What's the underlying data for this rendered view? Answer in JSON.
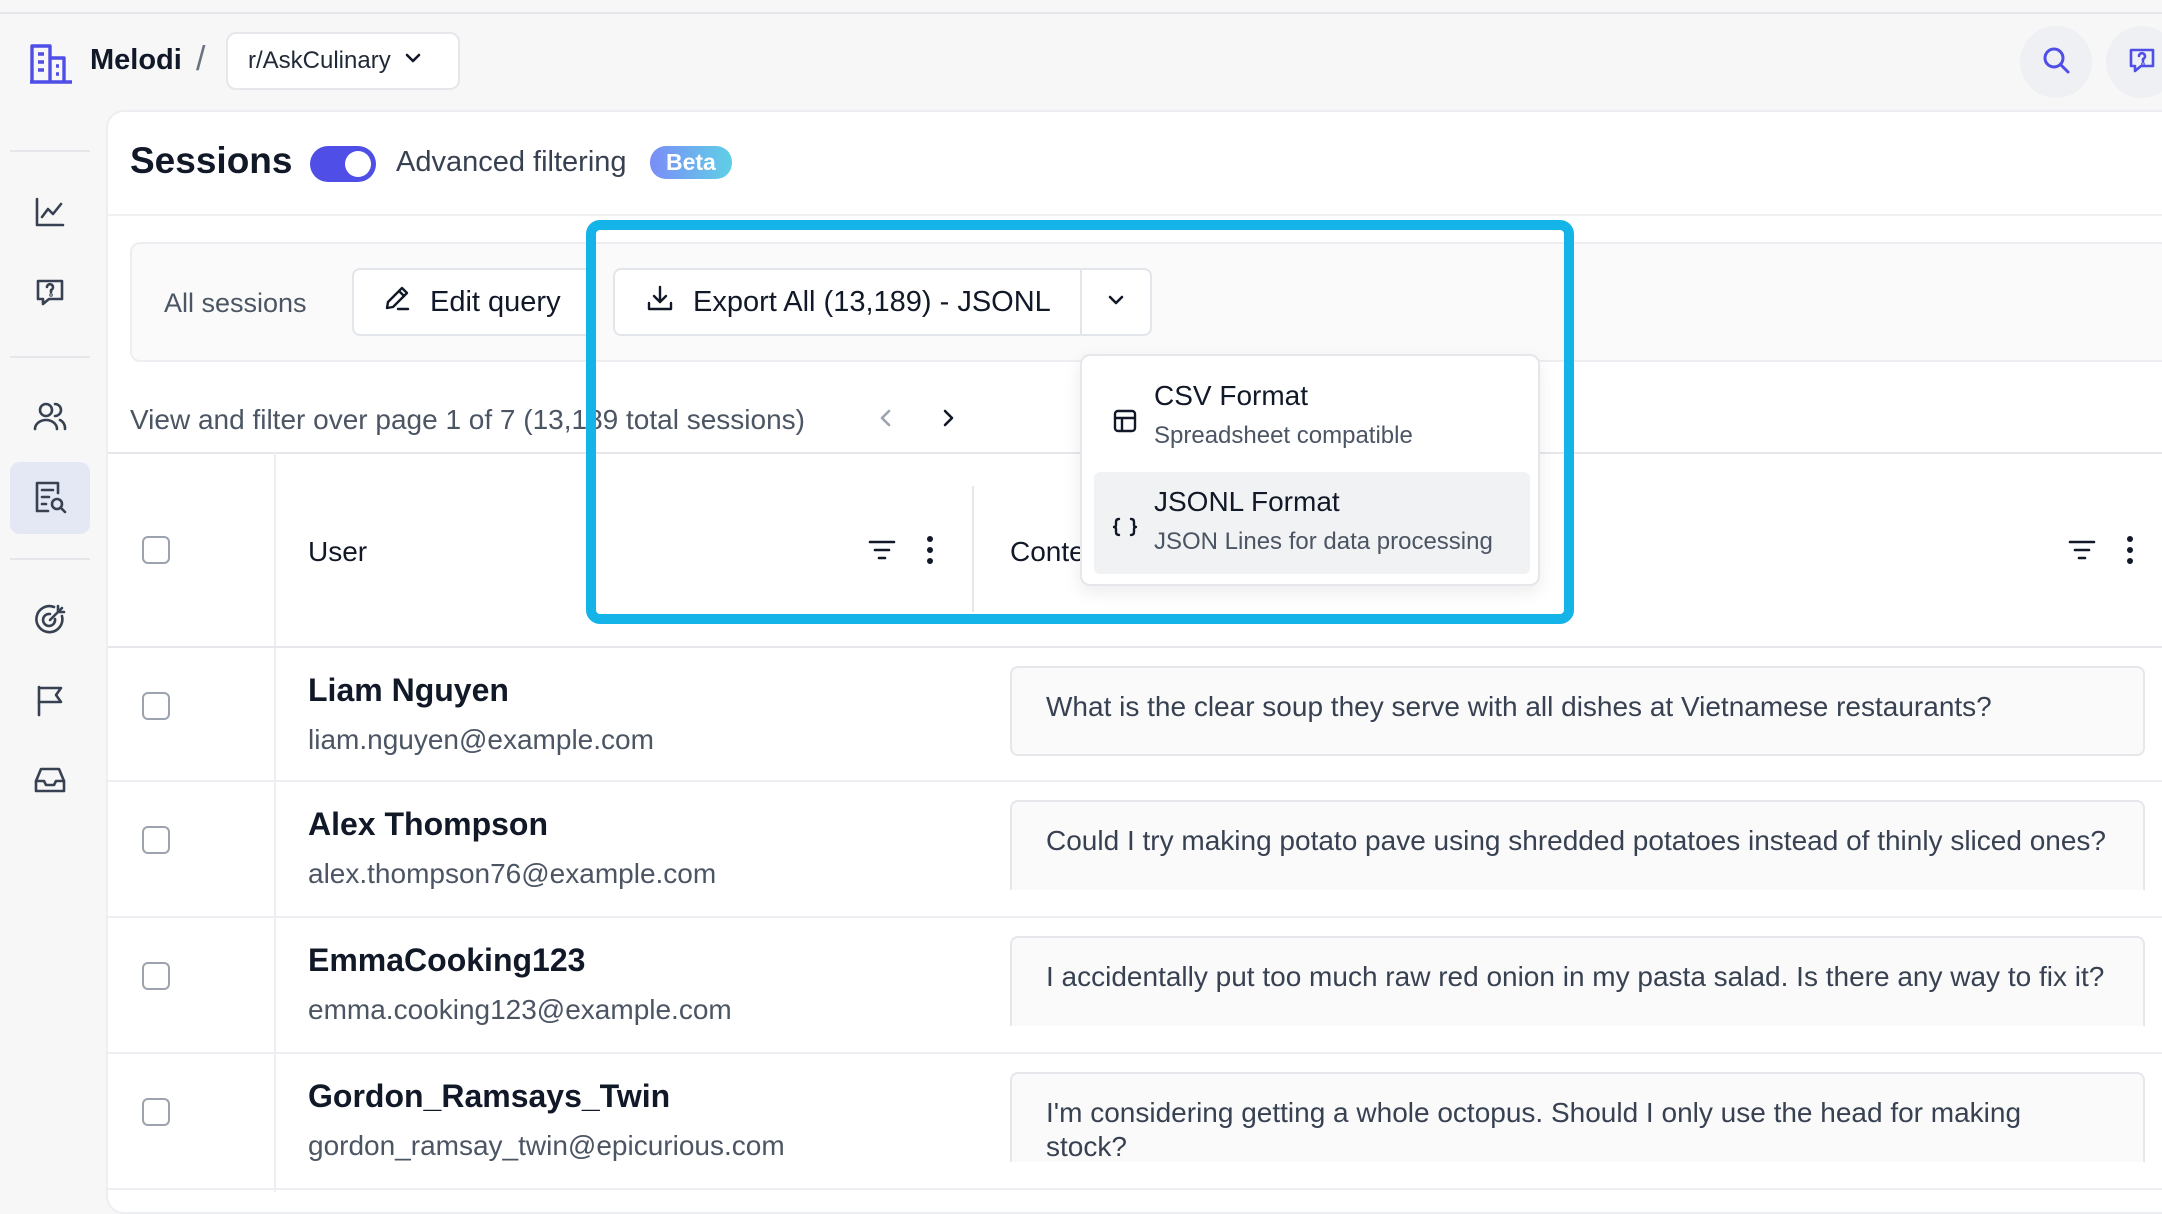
{
  "header": {
    "brand": "Melodi",
    "separator": "/",
    "workspace": "r/AskCulinary",
    "icons": [
      "building-icon",
      "search-icon",
      "help-chat-icon"
    ]
  },
  "sidebar": {
    "items": [
      {
        "name": "analytics",
        "icon": "chart-line-icon"
      },
      {
        "name": "feedback",
        "icon": "message-question-icon"
      },
      {
        "name": "users",
        "icon": "users-icon"
      },
      {
        "name": "sessions",
        "icon": "document-search-icon",
        "active": true
      },
      {
        "name": "evaluations",
        "icon": "target-icon"
      },
      {
        "name": "flags",
        "icon": "flag-icon"
      },
      {
        "name": "inbox",
        "icon": "inbox-icon"
      }
    ]
  },
  "page": {
    "title": "Sessions",
    "advanced_filtering_label": "Advanced filtering",
    "beta_badge": "Beta",
    "advanced_filtering_on": true
  },
  "toolbar": {
    "all_sessions": "All sessions",
    "edit_query": "Edit query",
    "export_all": "Export All (13,189) - JSONL"
  },
  "export_menu": {
    "items": [
      {
        "title": "CSV Format",
        "subtitle": "Spreadsheet compatible",
        "icon": "table-icon"
      },
      {
        "title": "JSONL Format",
        "subtitle": "JSON Lines for data processing",
        "icon": "braces-icon",
        "selected": true
      }
    ]
  },
  "pager": {
    "text": "View and filter over page 1 of 7 (13,189 total sessions)"
  },
  "table": {
    "columns": [
      "User",
      "Content"
    ],
    "rows": [
      {
        "name": "Liam Nguyen",
        "email": "liam.nguyen@example.com",
        "content": "What is the clear soup they serve with all dishes at Vietnamese restaurants?"
      },
      {
        "name": "Alex Thompson",
        "email": "alex.thompson76@example.com",
        "content": "Could I try making potato pave using shredded potatoes instead of thinly sliced ones?"
      },
      {
        "name": "EmmaCooking123",
        "email": "emma.cooking123@example.com",
        "content": "I accidentally put too much raw red onion in my pasta salad. Is there any way to fix it?"
      },
      {
        "name": "Gordon_Ramsays_Twin",
        "email": "gordon_ramsay_twin@epicurious.com",
        "content": "I'm considering getting a whole octopus. Should I only use the head for making stock?"
      }
    ]
  },
  "colors": {
    "accent": "#4f4ee6",
    "highlight": "#14b4e8"
  }
}
